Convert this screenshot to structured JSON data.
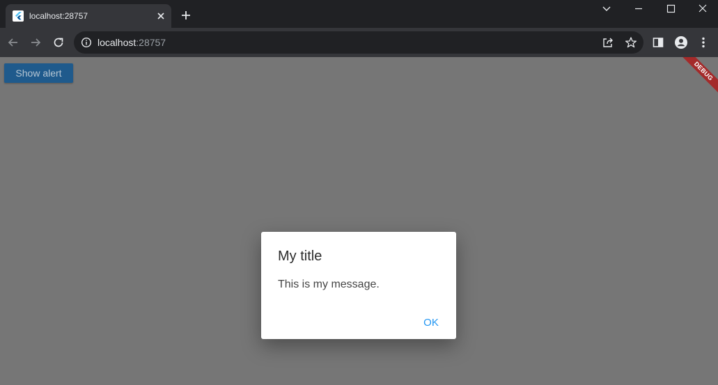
{
  "browser": {
    "tab": {
      "title": "localhost:28757"
    },
    "address_bar": {
      "host": "localhost",
      "port": ":28757"
    }
  },
  "app": {
    "show_alert_label": "Show alert",
    "debug_banner": "DEBUG"
  },
  "dialog": {
    "title": "My title",
    "message": "This is my message.",
    "ok_label": "OK"
  },
  "colors": {
    "scrim": "#767676",
    "button": "#1f5a8c",
    "dialog_action": "#2196f3",
    "debug_banner": "#a42a2a"
  }
}
